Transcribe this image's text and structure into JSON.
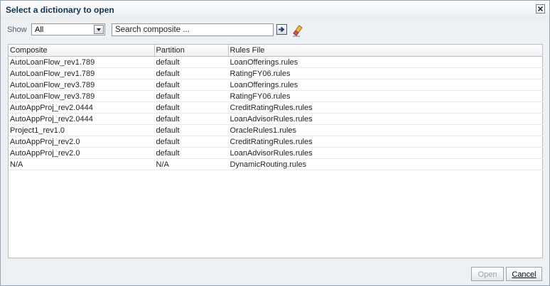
{
  "dialog": {
    "title": "Select a dictionary to open"
  },
  "toolbar": {
    "show_label": "Show",
    "show_value": "All",
    "search_placeholder": "Search composite ..."
  },
  "table": {
    "headers": [
      "Composite",
      "Partition",
      "Rules File"
    ],
    "rows": [
      [
        "AutoLoanFlow_rev1.789",
        "default",
        "LoanOfferings.rules"
      ],
      [
        "AutoLoanFlow_rev1.789",
        "default",
        "RatingFY06.rules"
      ],
      [
        "AutoLoanFlow_rev3.789",
        "default",
        "LoanOfferings.rules"
      ],
      [
        "AutoLoanFlow_rev3.789",
        "default",
        "RatingFY06.rules"
      ],
      [
        "AutoAppProj_rev2.0444",
        "default",
        "CreditRatingRules.rules"
      ],
      [
        "AutoAppProj_rev2.0444",
        "default",
        "LoanAdvisorRules.rules"
      ],
      [
        "Project1_rev1.0",
        "default",
        "OracleRules1.rules"
      ],
      [
        "AutoAppProj_rev2.0",
        "default",
        "CreditRatingRules.rules"
      ],
      [
        "AutoAppProj_rev2.0",
        "default",
        "LoanAdvisorRules.rules"
      ],
      [
        "N/A",
        "N/A",
        "DynamicRouting.rules"
      ]
    ]
  },
  "buttons": {
    "open": "Open",
    "cancel": "Cancel"
  },
  "colors": {
    "title_text": "#11324f",
    "accent": "#2a4f7a"
  }
}
